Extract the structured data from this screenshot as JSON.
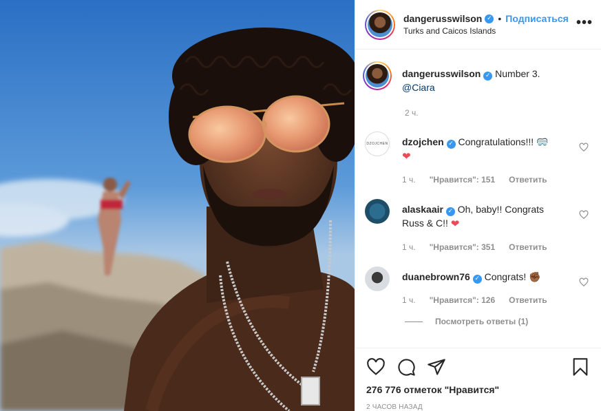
{
  "post": {
    "author": "dangerusswilson",
    "follow_label": "Подписаться",
    "separator": "•",
    "location": "Turks and Caicos Islands",
    "more_label": "•••",
    "verified_mark": "✓"
  },
  "caption": {
    "username": "dangerusswilson",
    "text": "Number 3.",
    "mention": "@Ciara",
    "time": "2 ч."
  },
  "comments": [
    {
      "username": "dzojchen",
      "text": "Congratulations!!! 🥽",
      "emoji": "❤",
      "time": "1 ч.",
      "likes": "\"Нравится\": 151",
      "reply": "Ответить",
      "avatar_text": "DZOJCHEN"
    },
    {
      "username": "alaskaair",
      "text": "Oh, baby!! Congrats Russ & C!!",
      "emoji": "❤",
      "time": "1 ч.",
      "likes": "\"Нравится\": 351",
      "reply": "Ответить"
    },
    {
      "username": "duanebrown76",
      "text": "Congrats! ✊🏾",
      "time": "1 ч.",
      "likes": "\"Нравится\": 126",
      "reply": "Ответить"
    }
  ],
  "view_replies": "Посмотреть ответы (1)",
  "actions": {
    "likes": "276 776 отметок \"Нравится\"",
    "posted": "2 ЧАСОВ НАЗАД"
  },
  "icons": {
    "like": "heart-icon",
    "comment": "comment-icon",
    "share": "share-icon",
    "save": "bookmark-icon",
    "more": "more-options-icon"
  },
  "colors": {
    "accent": "#3897f0",
    "text": "#262626",
    "muted": "#8e8e8e",
    "heart": "#ed4956"
  }
}
